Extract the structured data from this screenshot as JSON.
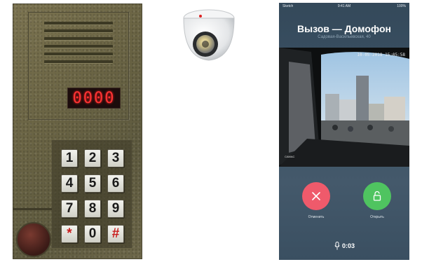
{
  "intercom": {
    "display_value": "0000",
    "keys": [
      "1",
      "2",
      "3",
      "4",
      "5",
      "6",
      "7",
      "8",
      "9",
      "*",
      "0",
      "#"
    ]
  },
  "phone": {
    "status": {
      "carrier": "Sketch",
      "time": "9:41 AM",
      "battery": "100%"
    },
    "title": "Вызов — Домофон",
    "subtitle": "Садовая-Васильевская, 40",
    "timestamp": "10-05-2018 15:05:58",
    "camera_label": "CAMAC",
    "decline_label": "Отменить",
    "open_label": "Открыть",
    "call_duration": "0:03"
  },
  "colors": {
    "decline": "#ef5a6b",
    "open": "#4fc460",
    "display": "#ff3434"
  }
}
